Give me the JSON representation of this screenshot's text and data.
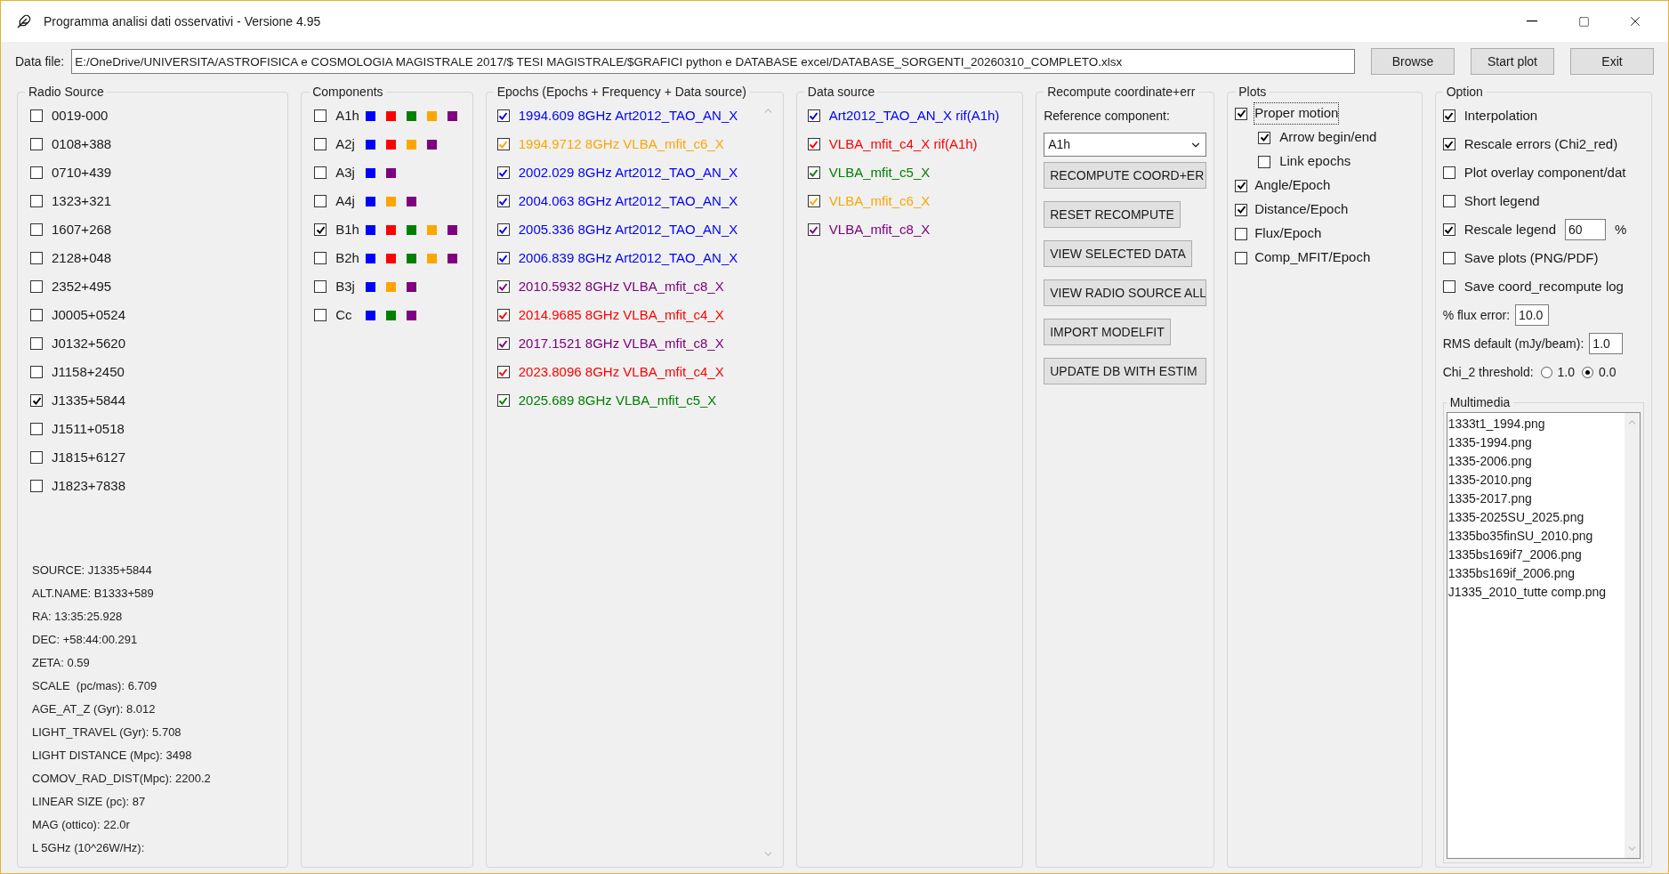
{
  "window": {
    "title": "Programma analisi dati osservativi - Versione 4.95"
  },
  "data_file": {
    "label": "Data file:",
    "value": "E:/OneDrive/UNIVERSITA/ASTROFISICA e COSMOLOGIA MAGISTRALE 2017/$ TESI MAGISTRALE/$GRAFICI python e DATABASE excel/DATABASE_SORGENTI_20260310_COMPLETO.xlsx",
    "buttons": [
      "Browse",
      "Start plot",
      "Exit"
    ]
  },
  "radio_source": {
    "title": "Radio Source",
    "items": [
      {
        "label": "0019-000",
        "checked": false
      },
      {
        "label": "0108+388",
        "checked": false
      },
      {
        "label": "0710+439",
        "checked": false
      },
      {
        "label": "1323+321",
        "checked": false
      },
      {
        "label": "1607+268",
        "checked": false
      },
      {
        "label": "2128+048",
        "checked": false
      },
      {
        "label": "2352+495",
        "checked": false
      },
      {
        "label": "J0005+0524",
        "checked": false
      },
      {
        "label": "J0132+5620",
        "checked": false
      },
      {
        "label": "J1158+2450",
        "checked": false
      },
      {
        "label": "J1335+5844",
        "checked": true
      },
      {
        "label": "J1511+0518",
        "checked": false
      },
      {
        "label": "J1815+6127",
        "checked": false
      },
      {
        "label": "J1823+7838",
        "checked": false
      }
    ],
    "info": [
      "SOURCE: J1335+5844",
      "ALT.NAME: B1333+589",
      "RA: 13:35:25.928",
      "DEC: +58:44:00.291",
      "ZETA: 0.59",
      "SCALE  (pc/mas): 6.709",
      "AGE_AT_Z (Gyr): 8.012",
      "LIGHT_TRAVEL (Gyr): 5.708",
      "LIGHT DISTANCE (Mpc): 3498",
      "COMOV_RAD_DIST(Mpc): 2200.2",
      "LINEAR SIZE (pc): 87",
      "MAG (ottico): 22.0r",
      "L 5GHz (10^26W/Hz):"
    ]
  },
  "components": {
    "title": "Components",
    "items": [
      {
        "label": "A1h",
        "checked": false,
        "swatches": [
          {
            "color": "#0000ff"
          },
          {
            "color": "#ff0000"
          },
          {
            "color": "#008000"
          },
          {
            "color": "#ffa500"
          },
          {
            "color": "#800080"
          }
        ]
      },
      {
        "label": "A2j",
        "checked": false,
        "swatches": [
          {
            "color": "#0000ff"
          },
          {
            "color": "#ff0000"
          },
          {
            "color": "#ffa500"
          },
          {
            "color": "#800080"
          }
        ]
      },
      {
        "label": "A3j",
        "checked": false,
        "swatches": [
          {
            "color": "#0000ff"
          },
          {
            "color": "#800080"
          }
        ]
      },
      {
        "label": "A4j",
        "checked": false,
        "swatches": [
          {
            "color": "#0000ff"
          },
          {
            "color": "#ffa500"
          },
          {
            "color": "#800080"
          }
        ]
      },
      {
        "label": "B1h",
        "checked": true,
        "swatches": [
          {
            "color": "#0000ff"
          },
          {
            "color": "#ff0000"
          },
          {
            "color": "#008000"
          },
          {
            "color": "#ffa500"
          },
          {
            "color": "#800080"
          }
        ]
      },
      {
        "label": "B2h",
        "checked": false,
        "swatches": [
          {
            "color": "#0000ff"
          },
          {
            "color": "#ff0000"
          },
          {
            "color": "#008000"
          },
          {
            "color": "#ffa500"
          },
          {
            "color": "#800080"
          }
        ]
      },
      {
        "label": "B3j",
        "checked": false,
        "swatches": [
          {
            "color": "#0000ff"
          },
          {
            "color": "#ffa500"
          },
          {
            "color": "#800080"
          }
        ]
      },
      {
        "label": "Cc",
        "checked": false,
        "swatches": [
          {
            "color": "#0000ff"
          },
          {
            "color": "#008000"
          },
          {
            "color": "#800080"
          }
        ]
      }
    ]
  },
  "epochs": {
    "title": "Epochs (Epochs + Frequency + Data source)",
    "items": [
      {
        "label": "1994.609 8GHz Art2012_TAO_AN_X",
        "checked": true,
        "color": "#0000ff"
      },
      {
        "label": "1994.9712 8GHz VLBA_mfit_c6_X",
        "checked": true,
        "color": "#ffa500"
      },
      {
        "label": "2002.029 8GHz Art2012_TAO_AN_X",
        "checked": true,
        "color": "#0000ff"
      },
      {
        "label": "2004.063 8GHz Art2012_TAO_AN_X",
        "checked": true,
        "color": "#0000ff"
      },
      {
        "label": "2005.336 8GHz Art2012_TAO_AN_X",
        "checked": true,
        "color": "#0000ff"
      },
      {
        "label": "2006.839 8GHz Art2012_TAO_AN_X",
        "checked": true,
        "color": "#0000ff"
      },
      {
        "label": "2010.5932 8GHz VLBA_mfit_c8_X",
        "checked": true,
        "color": "#800080"
      },
      {
        "label": "2014.9685 8GHz VLBA_mfit_c4_X",
        "checked": true,
        "color": "#ff0000"
      },
      {
        "label": "2017.1521 8GHz VLBA_mfit_c8_X",
        "checked": true,
        "color": "#800080"
      },
      {
        "label": "2023.8096 8GHz VLBA_mfit_c4_X",
        "checked": true,
        "color": "#ff0000"
      },
      {
        "label": "2025.689 8GHz VLBA_mfit_c5_X",
        "checked": true,
        "color": "#008000"
      }
    ]
  },
  "data_source": {
    "title": "Data source",
    "items": [
      {
        "label": "Art2012_TAO_AN_X rif(A1h)",
        "checked": true,
        "color": "#0000ff"
      },
      {
        "label": "VLBA_mfit_c4_X rif(A1h)",
        "checked": true,
        "color": "#ff0000"
      },
      {
        "label": "VLBA_mfit_c5_X",
        "checked": true,
        "color": "#008000"
      },
      {
        "label": "VLBA_mfit_c6_X",
        "checked": true,
        "color": "#ffa500"
      },
      {
        "label": "VLBA_mfit_c8_X",
        "checked": true,
        "color": "#800080"
      }
    ]
  },
  "recompute": {
    "title": "Recompute coordinate+err",
    "reference_label": "Reference component:",
    "reference_value": "A1h",
    "buttons": [
      "RECOMPUTE COORD+ER",
      "RESET RECOMPUTE",
      "VIEW SELECTED DATA",
      "VIEW RADIO SOURCE ALL",
      "IMPORT MODELFIT",
      "UPDATE DB WITH ESTIM"
    ]
  },
  "plots": {
    "title": "Plots",
    "items": [
      {
        "label": "Proper motion",
        "checked": true,
        "focused": true,
        "children": [
          {
            "label": "Arrow begin/end",
            "checked": true
          },
          {
            "label": "Link epochs",
            "checked": false
          }
        ]
      },
      {
        "label": "Angle/Epoch",
        "checked": true
      },
      {
        "label": "Distance/Epoch",
        "checked": true
      },
      {
        "label": "Flux/Epoch",
        "checked": false
      },
      {
        "label": "Comp_MFIT/Epoch",
        "checked": false
      }
    ]
  },
  "option": {
    "title": "Option",
    "items": [
      {
        "kind": "checkbox",
        "label": "Interpolation",
        "checked": true
      },
      {
        "kind": "checkbox",
        "label": "Rescale errors (Chi2_red)",
        "checked": true
      },
      {
        "kind": "checkbox",
        "label": "Plot overlay component/dat",
        "checked": false
      },
      {
        "kind": "checkbox",
        "label": "Short legend",
        "checked": false
      },
      {
        "kind": "checkbox_field",
        "label": "Rescale legend",
        "checked": true,
        "value": "60",
        "unit": "%"
      },
      {
        "kind": "checkbox",
        "label": "Save plots (PNG/PDF)",
        "checked": false
      },
      {
        "kind": "checkbox",
        "label": "Save coord_recompute log",
        "checked": false
      },
      {
        "kind": "field",
        "label": "% flux error:",
        "value": "10.0"
      },
      {
        "kind": "field",
        "label": "RMS default (mJy/beam):",
        "value": "1.0"
      },
      {
        "kind": "radio",
        "label": "Chi_2 threshold:",
        "options": [
          {
            "label": "1.0",
            "selected": false
          },
          {
            "label": "0.0",
            "selected": true
          }
        ]
      }
    ],
    "multimedia": {
      "title": "Multimedia",
      "files": [
        "1333t1_1994.png",
        "1335-1994.png",
        "1335-2006.png",
        "1335-2010.png",
        "1335-2017.png",
        "1335-2025SU_2025.png",
        "1335bo35finSU_2010.png",
        "1335bs169if7_2006.png",
        "1335bs169if_2006.png",
        "J1335_2010_tutte comp.png"
      ]
    }
  }
}
